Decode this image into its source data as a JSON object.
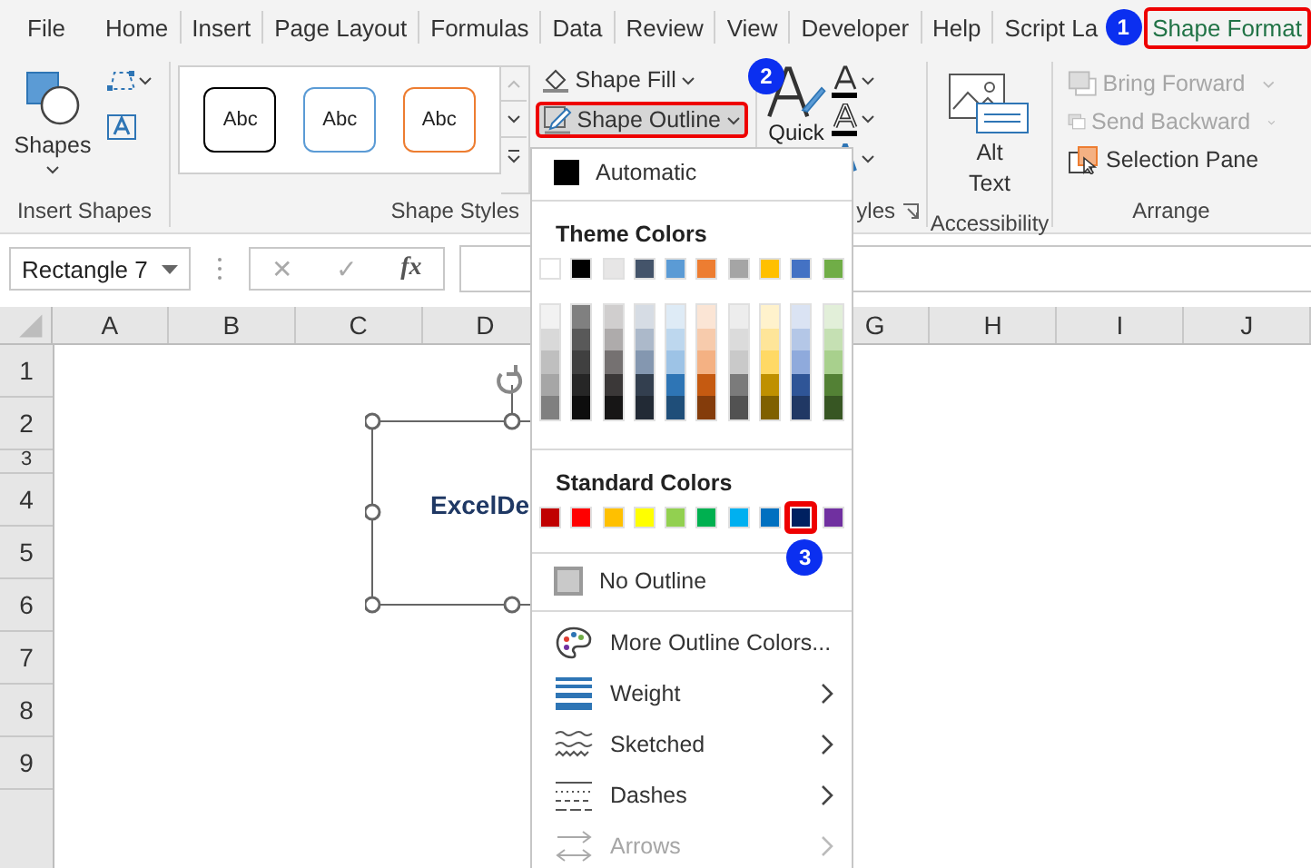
{
  "tabs": [
    {
      "label": "File",
      "selected": false
    },
    {
      "label": "Home",
      "selected": false
    },
    {
      "label": "Insert",
      "selected": false
    },
    {
      "label": "Page Layout",
      "selected": false
    },
    {
      "label": "Formulas",
      "selected": false
    },
    {
      "label": "Data",
      "selected": false
    },
    {
      "label": "Review",
      "selected": false
    },
    {
      "label": "View",
      "selected": false
    },
    {
      "label": "Developer",
      "selected": false
    },
    {
      "label": "Help",
      "selected": false
    },
    {
      "label": "Script La",
      "selected": false
    },
    {
      "label": "Shape Format",
      "selected": true,
      "callout": "1"
    }
  ],
  "ribbon": {
    "insert_shapes": {
      "shapes_label": "Shapes",
      "group_label": "Insert Shapes"
    },
    "shape_styles": {
      "presets": [
        {
          "label": "Abc",
          "color": "#000000"
        },
        {
          "label": "Abc",
          "color": "#5b9bd5"
        },
        {
          "label": "Abc",
          "color": "#ed7d31"
        }
      ],
      "fill_label": "Shape Fill",
      "outline": {
        "label": "Shape Outline",
        "open": true,
        "callout": "2"
      },
      "group_label": "Shape Styles"
    },
    "wordart": {
      "quick_label": "Quick",
      "group_label": "yles"
    },
    "accessibility": {
      "alt_text_label": "Alt Text",
      "group_label": "Accessibility"
    },
    "arrange": {
      "items": [
        {
          "label": "Bring Forward",
          "disabled": true
        },
        {
          "label": "Send Backward",
          "disabled": true
        },
        {
          "label": "Selection Pane",
          "disabled": false
        }
      ],
      "group_label": "Arrange"
    }
  },
  "formula_bar": {
    "name_box": "Rectangle 7",
    "cancel": "✕",
    "enter": "✓",
    "function": "fx"
  },
  "sheet": {
    "columns_left": [
      "A",
      "B",
      "C",
      "D"
    ],
    "columns_right": [
      "G",
      "H",
      "I",
      "J"
    ],
    "rows": [
      {
        "label": "1",
        "short": false
      },
      {
        "label": "2",
        "short": false
      },
      {
        "label": "3",
        "short": true
      },
      {
        "label": "4",
        "short": false
      },
      {
        "label": "5",
        "short": false
      },
      {
        "label": "6",
        "short": false
      },
      {
        "label": "7",
        "short": false
      },
      {
        "label": "8",
        "short": false
      },
      {
        "label": "9",
        "short": false
      }
    ],
    "shape_text": "ExcelDe"
  },
  "outline_menu": {
    "automatic": "Automatic",
    "theme_heading": "Theme Colors",
    "theme_colors": [
      {
        "color": "#ffffff",
        "shades": [
          {
            "color": "#f2f2f2"
          },
          {
            "color": "#d9d9d9"
          },
          {
            "color": "#bfbfbf"
          },
          {
            "color": "#a6a6a6"
          },
          {
            "color": "#808080"
          }
        ]
      },
      {
        "color": "#000000",
        "shades": [
          {
            "color": "#808080"
          },
          {
            "color": "#595959"
          },
          {
            "color": "#404040"
          },
          {
            "color": "#262626"
          },
          {
            "color": "#0d0d0d"
          }
        ]
      },
      {
        "color": "#e7e6e6",
        "shades": [
          {
            "color": "#d0cece"
          },
          {
            "color": "#aeabab"
          },
          {
            "color": "#757171"
          },
          {
            "color": "#3b3838"
          },
          {
            "color": "#171616"
          }
        ]
      },
      {
        "color": "#44546a",
        "shades": [
          {
            "color": "#d6dce4"
          },
          {
            "color": "#acb9ca"
          },
          {
            "color": "#8497b0"
          },
          {
            "color": "#333f4f"
          },
          {
            "color": "#222a35"
          }
        ]
      },
      {
        "color": "#5b9bd5",
        "shades": [
          {
            "color": "#deebf6"
          },
          {
            "color": "#bdd7ee"
          },
          {
            "color": "#9dc3e6"
          },
          {
            "color": "#2e75b5"
          },
          {
            "color": "#1f4e79"
          }
        ]
      },
      {
        "color": "#ed7d31",
        "shades": [
          {
            "color": "#fbe5d5"
          },
          {
            "color": "#f7cbac"
          },
          {
            "color": "#f4b183"
          },
          {
            "color": "#c55a11"
          },
          {
            "color": "#843c0b"
          }
        ]
      },
      {
        "color": "#a5a5a5",
        "shades": [
          {
            "color": "#ededed"
          },
          {
            "color": "#dbdbdb"
          },
          {
            "color": "#c9c9c9"
          },
          {
            "color": "#7b7b7b"
          },
          {
            "color": "#525252"
          }
        ]
      },
      {
        "color": "#ffc000",
        "shades": [
          {
            "color": "#fff2cc"
          },
          {
            "color": "#fee599"
          },
          {
            "color": "#ffd965"
          },
          {
            "color": "#bf9000"
          },
          {
            "color": "#7f6000"
          }
        ]
      },
      {
        "color": "#4472c4",
        "shades": [
          {
            "color": "#dae3f3"
          },
          {
            "color": "#b4c7e7"
          },
          {
            "color": "#8faadc"
          },
          {
            "color": "#2f5597"
          },
          {
            "color": "#203864"
          }
        ]
      },
      {
        "color": "#70ad47",
        "shades": [
          {
            "color": "#e2efd9"
          },
          {
            "color": "#c5e0b3"
          },
          {
            "color": "#a8d08d"
          },
          {
            "color": "#538135"
          },
          {
            "color": "#375623"
          }
        ]
      }
    ],
    "standard_heading": "Standard Colors",
    "standard_colors": [
      {
        "color": "#c00000",
        "selected": false
      },
      {
        "color": "#ff0000",
        "selected": false
      },
      {
        "color": "#ffc000",
        "selected": false
      },
      {
        "color": "#ffff00",
        "selected": false
      },
      {
        "color": "#92d050",
        "selected": false
      },
      {
        "color": "#00b050",
        "selected": false
      },
      {
        "color": "#00b0f0",
        "selected": false
      },
      {
        "color": "#0070c0",
        "selected": false
      },
      {
        "color": "#002060",
        "selected": true,
        "callout": "3"
      },
      {
        "color": "#7030a0",
        "selected": false
      }
    ],
    "no_outline": "No Outline",
    "options": [
      {
        "label": "More Outline Colors...",
        "kind": "palette",
        "submenu": false,
        "disabled": false
      },
      {
        "label": "Weight",
        "kind": "weight",
        "submenu": true,
        "disabled": false
      },
      {
        "label": "Sketched",
        "kind": "sketched",
        "submenu": true,
        "disabled": false
      },
      {
        "label": "Dashes",
        "kind": "dashes",
        "submenu": true,
        "disabled": false
      },
      {
        "label": "Arrows",
        "kind": "arrows",
        "submenu": true,
        "disabled": true
      }
    ]
  }
}
